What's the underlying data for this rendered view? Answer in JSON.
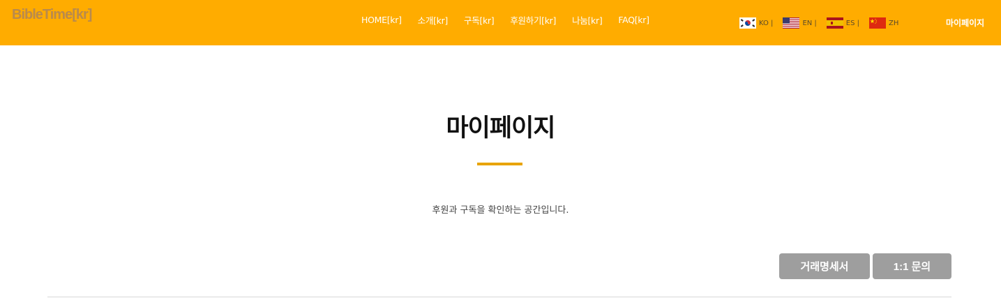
{
  "header": {
    "logo": "BibleTime[kr]",
    "nav": [
      {
        "label": "HOME[kr]"
      },
      {
        "label": "소개[kr]"
      },
      {
        "label": "구독[kr]"
      },
      {
        "label": "후원하기[kr]"
      },
      {
        "label": "나눔[kr]"
      },
      {
        "label": "FAQ[kr]"
      }
    ],
    "languages": [
      {
        "code": "KO |",
        "flag_icon": "korea-flag-icon"
      },
      {
        "code": "EN |",
        "flag_icon": "usa-flag-icon"
      },
      {
        "code": "ES |",
        "flag_icon": "spain-flag-icon"
      },
      {
        "code": "ZH",
        "flag_icon": "china-flag-icon"
      }
    ],
    "mypage_link": "마이페이지"
  },
  "main": {
    "title": "마이페이지",
    "subtitle": "후원과 구독을 확인하는 공간입니다.",
    "buttons": {
      "receipt": "거래명세서",
      "inquiry": "1:1 문의"
    }
  },
  "colors": {
    "header_bg": "#FFAC00",
    "accent": "#E8A400",
    "button_bg": "#9E9E9E"
  }
}
